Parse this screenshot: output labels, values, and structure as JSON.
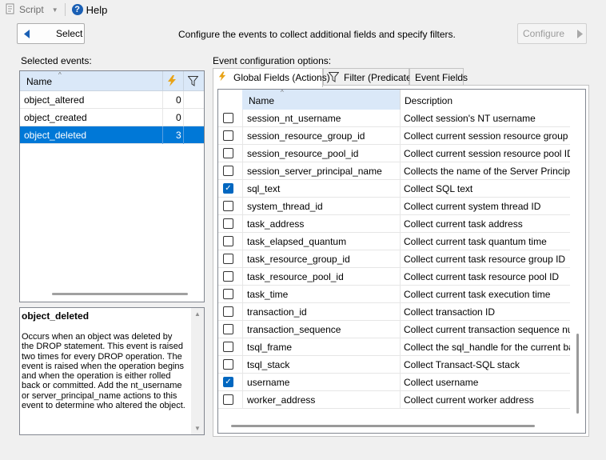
{
  "toolbar": {
    "script_label": "Script",
    "help_label": "Help"
  },
  "nav": {
    "select_label": "Select",
    "instructions": "Configure the events to collect additional fields and specify filters.",
    "configure_label": "Configure"
  },
  "selected_events": {
    "label": "Selected events:",
    "header_name": "Name",
    "rows": [
      {
        "name": "object_altered",
        "count": "0",
        "selected": false
      },
      {
        "name": "object_created",
        "count": "0",
        "selected": false
      },
      {
        "name": "object_deleted",
        "count": "3",
        "selected": true
      }
    ]
  },
  "description": {
    "title": "object_deleted",
    "body": "Occurs when an object was deleted by the DROP statement. This event is raised two times for every DROP operation. The event is raised when the operation begins and when the operation is either rolled back or committed. Add the nt_username or server_principal_name actions to this event to determine who altered the object."
  },
  "config": {
    "label": "Event configuration options:",
    "tabs": [
      {
        "label": "Global Fields (Actions)",
        "active": true
      },
      {
        "label": "Filter (Predicate)",
        "active": false
      },
      {
        "label": "Event Fields",
        "active": false
      }
    ],
    "header_name": "Name",
    "header_description": "Description",
    "rows": [
      {
        "name": "session_nt_username",
        "description": "Collect session's NT username",
        "checked": false
      },
      {
        "name": "session_resource_group_id",
        "description": "Collect current session resource group ID",
        "checked": false
      },
      {
        "name": "session_resource_pool_id",
        "description": "Collect current session resource pool ID",
        "checked": false
      },
      {
        "name": "session_server_principal_name",
        "description": "Collects the name of the Server Principal tha",
        "checked": false
      },
      {
        "name": "sql_text",
        "description": "Collect SQL text",
        "checked": true
      },
      {
        "name": "system_thread_id",
        "description": "Collect current system thread ID",
        "checked": false
      },
      {
        "name": "task_address",
        "description": "Collect current task address",
        "checked": false
      },
      {
        "name": "task_elapsed_quantum",
        "description": "Collect current task quantum time",
        "checked": false
      },
      {
        "name": "task_resource_group_id",
        "description": "Collect current task resource group ID",
        "checked": false
      },
      {
        "name": "task_resource_pool_id",
        "description": "Collect current task resource pool ID",
        "checked": false
      },
      {
        "name": "task_time",
        "description": "Collect current task execution time",
        "checked": false
      },
      {
        "name": "transaction_id",
        "description": "Collect transaction ID",
        "checked": false
      },
      {
        "name": "transaction_sequence",
        "description": "Collect current transaction sequence numbe",
        "checked": false
      },
      {
        "name": "tsql_frame",
        "description": "Collect the sql_handle for the current batch v",
        "checked": false
      },
      {
        "name": "tsql_stack",
        "description": "Collect Transact-SQL stack",
        "checked": false
      },
      {
        "name": "username",
        "description": "Collect username",
        "checked": true
      },
      {
        "name": "worker_address",
        "description": "Collect current worker address",
        "checked": false
      }
    ]
  },
  "colors": {
    "selection": "#0078d7",
    "header_highlight": "#dae8f8",
    "checkbox_on": "#0067c0",
    "lightning": "#e8a317"
  }
}
